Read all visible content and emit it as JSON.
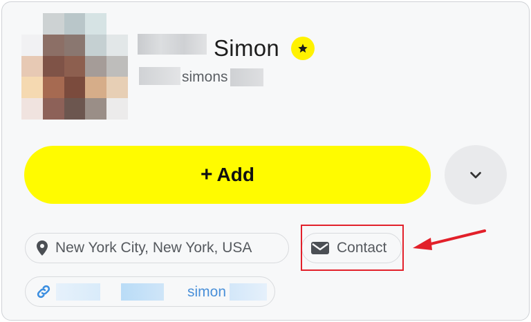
{
  "profile": {
    "display_name": "Simon",
    "username": "simons",
    "star_icon": "star-icon",
    "star_color": "#fff200"
  },
  "actions": {
    "add_label": "Add",
    "add_plus": "+",
    "add_color": "#fffb00",
    "more_icon": "chevron-down-icon"
  },
  "details": {
    "location": "New York City, New York, USA",
    "contact_label": "Contact",
    "link_text": "simon"
  },
  "annotation": {
    "highlight_color": "#e2202a"
  }
}
